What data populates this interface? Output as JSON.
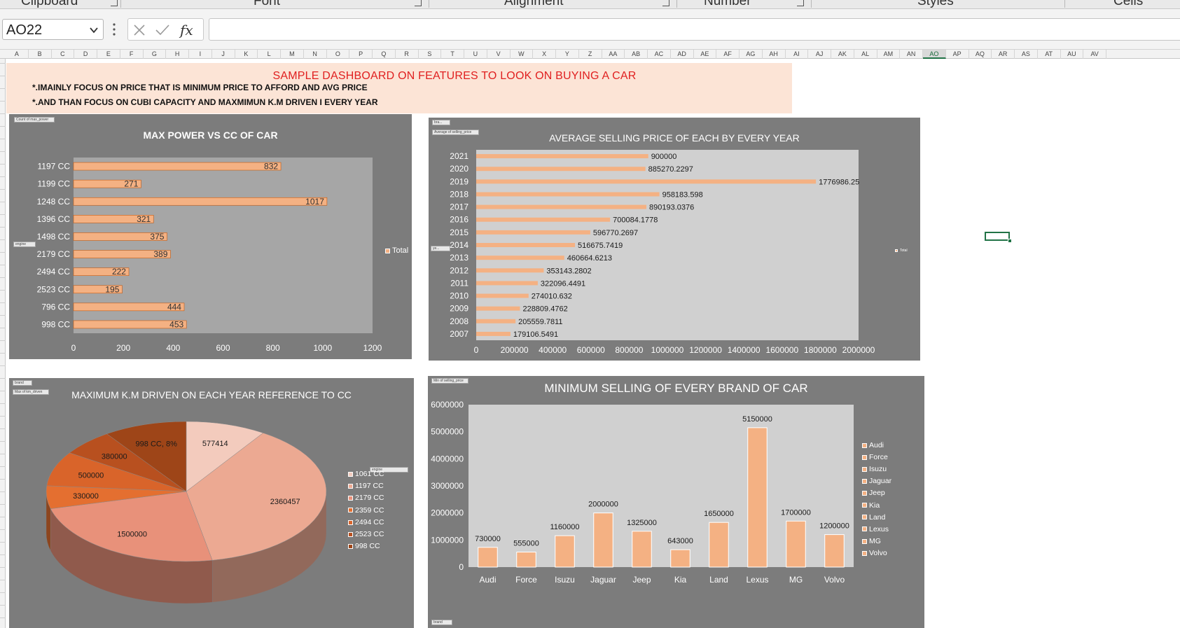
{
  "ribbon": {
    "groups": [
      "Clipboard",
      "Font",
      "Alignment",
      "Number",
      "Styles",
      "Cells"
    ]
  },
  "formula_bar": {
    "name_box": "AO22",
    "formula": ""
  },
  "columns": [
    "A",
    "B",
    "C",
    "D",
    "E",
    "F",
    "G",
    "H",
    "I",
    "J",
    "K",
    "L",
    "M",
    "N",
    "O",
    "P",
    "Q",
    "R",
    "S",
    "T",
    "U",
    "V",
    "W",
    "X",
    "Y",
    "Z",
    "AA",
    "AB",
    "AC",
    "AD",
    "AE",
    "AF",
    "AG",
    "AH",
    "AI",
    "AJ",
    "AK",
    "AL",
    "AM",
    "AN",
    "AO",
    "AP",
    "AQ",
    "AR",
    "AS",
    "AT",
    "AU",
    "AV"
  ],
  "active_column": "AO",
  "dashboard": {
    "title": "SAMPLE  DASHBOARD ON FEATURES TO LOOK ON BUYING A CAR",
    "note_1": "*.IMAINLY  FOCUS ON PRICE THAT IS MINIMUM PRICE TO AFFORD  AND AVG PRICE",
    "note_2": "*.AND THAN FOCUS ON CUBI  CAPACITY    AND    MAXMIMUN K.M DRIVEN I EVERY YEAR"
  },
  "colors": {
    "bar": "#f4b183",
    "bar_stroke": "#c55a11",
    "panel": "#7c7c7c",
    "plot": "#a6a6a6",
    "plot_light": "#d0d0d0",
    "title_band": "#fce4d6",
    "title_red": "#e02020",
    "selection": "#217346"
  },
  "charts": {
    "max_power": {
      "field_buttons": [
        "Count of max_power",
        "engine"
      ],
      "legend": [
        "Total"
      ]
    },
    "avg_price": {
      "field_buttons": [
        "bra...",
        "Average of selling_price",
        "ye..."
      ],
      "legend": [
        "Total"
      ]
    },
    "km_driven": {
      "field_buttons": [
        "brand",
        "Max of km_driven"
      ],
      "legend_header": "engine"
    },
    "min_price": {
      "field_buttons": [
        "Min of selling_price",
        "brand"
      ]
    }
  },
  "chart_data": [
    {
      "id": "max_power",
      "type": "bar",
      "orientation": "horizontal",
      "title": "MAX  POWER VS CC OF CAR",
      "categories": [
        "1197 CC",
        "1199 CC",
        "1248 CC",
        "1396 CC",
        "1498 CC",
        "2179 CC",
        "2494 CC",
        "2523 CC",
        "796 CC",
        "998 CC"
      ],
      "values": [
        832,
        271,
        1017,
        321,
        375,
        389,
        222,
        195,
        444,
        453
      ],
      "series": [
        {
          "name": "Total",
          "values": [
            832,
            271,
            1017,
            321,
            375,
            389,
            222,
            195,
            444,
            453
          ]
        }
      ],
      "xlim": [
        0,
        1200
      ],
      "xticks": [
        0,
        200,
        400,
        600,
        800,
        1000,
        1200
      ],
      "legend_position": "right",
      "data_labels": true
    },
    {
      "id": "avg_price",
      "type": "bar",
      "orientation": "horizontal",
      "title": "AVERAGE SELLING PRICE OF EACH BY EVERY YEAR",
      "categories": [
        "2021",
        "2020",
        "2019",
        "2018",
        "2017",
        "2016",
        "2015",
        "2014",
        "2013",
        "2012",
        "2011",
        "2010",
        "2009",
        "2008",
        "2007"
      ],
      "values": [
        900000,
        885270.2297,
        1776986.25,
        958183.598,
        890193.0376,
        700084.1778,
        596770.2697,
        516675.7419,
        460664.6213,
        353143.2802,
        322096.4491,
        274010.632,
        228809.4762,
        205559.7811,
        179106.5491
      ],
      "data_label_text": [
        "900000",
        "885270.2297",
        "1776986.25",
        "958183.598",
        "890193.0376",
        "700084.1778",
        "596770.2697",
        "516675.7419",
        "460664.6213",
        "353143.2802",
        "322096.4491",
        "274010.632",
        "228809.4762",
        "205559.7811",
        "179106.5491"
      ],
      "series": [
        {
          "name": "Total",
          "values": [
            900000,
            885270.2297,
            1776986.25,
            958183.598,
            890193.0376,
            700084.1778,
            596770.2697,
            516675.7419,
            460664.6213,
            353143.2802,
            322096.4491,
            274010.632,
            228809.4762,
            205559.7811,
            179106.5491
          ]
        }
      ],
      "xlim": [
        0,
        2000000
      ],
      "xticks": [
        0,
        200000,
        400000,
        600000,
        800000,
        1000000,
        1200000,
        1400000,
        1600000,
        1800000,
        2000000
      ],
      "legend_position": "right",
      "data_labels": true
    },
    {
      "id": "km_driven",
      "type": "pie",
      "style": "3d",
      "title": "MAXIMUM K.M DRIVEN ON EACH YEAR  REFERENCE TO CC",
      "categories": [
        "1061 CC",
        "1197 CC",
        "2179 CC",
        "2359 CC",
        "2494 CC",
        "2523 CC",
        "998 CC"
      ],
      "values": [
        577414,
        2360457,
        1500000,
        330000,
        500000,
        380000,
        600000
      ],
      "data_label_text": [
        "577414",
        "2360457",
        "1500000",
        "330000",
        "500000",
        "380000",
        "998 CC, 8%"
      ],
      "colors": [
        "#f3cbbd",
        "#eca992",
        "#e8917a",
        "#e46f30",
        "#d9642a",
        "#b8501f",
        "#9e4518"
      ],
      "legend_position": "right"
    },
    {
      "id": "min_price",
      "type": "bar",
      "orientation": "vertical",
      "title": "MINIMUM SELLING OF EVERY  BRAND OF CAR",
      "categories": [
        "Audi",
        "Force",
        "Isuzu",
        "Jaguar",
        "Jeep",
        "Kia",
        "Land",
        "Lexus",
        "MG",
        "Volvo"
      ],
      "values": [
        730000,
        555000,
        1160000,
        2000000,
        1325000,
        643000,
        1650000,
        5150000,
        1700000,
        1200000
      ],
      "ylim": [
        0,
        6000000
      ],
      "yticks": [
        0,
        1000000,
        2000000,
        3000000,
        4000000,
        5000000,
        6000000
      ],
      "legend": [
        "Audi",
        "Force",
        "Isuzu",
        "Jaguar",
        "Jeep",
        "Kia",
        "Land",
        "Lexus",
        "MG",
        "Volvo"
      ],
      "legend_position": "right",
      "data_labels": true
    }
  ]
}
